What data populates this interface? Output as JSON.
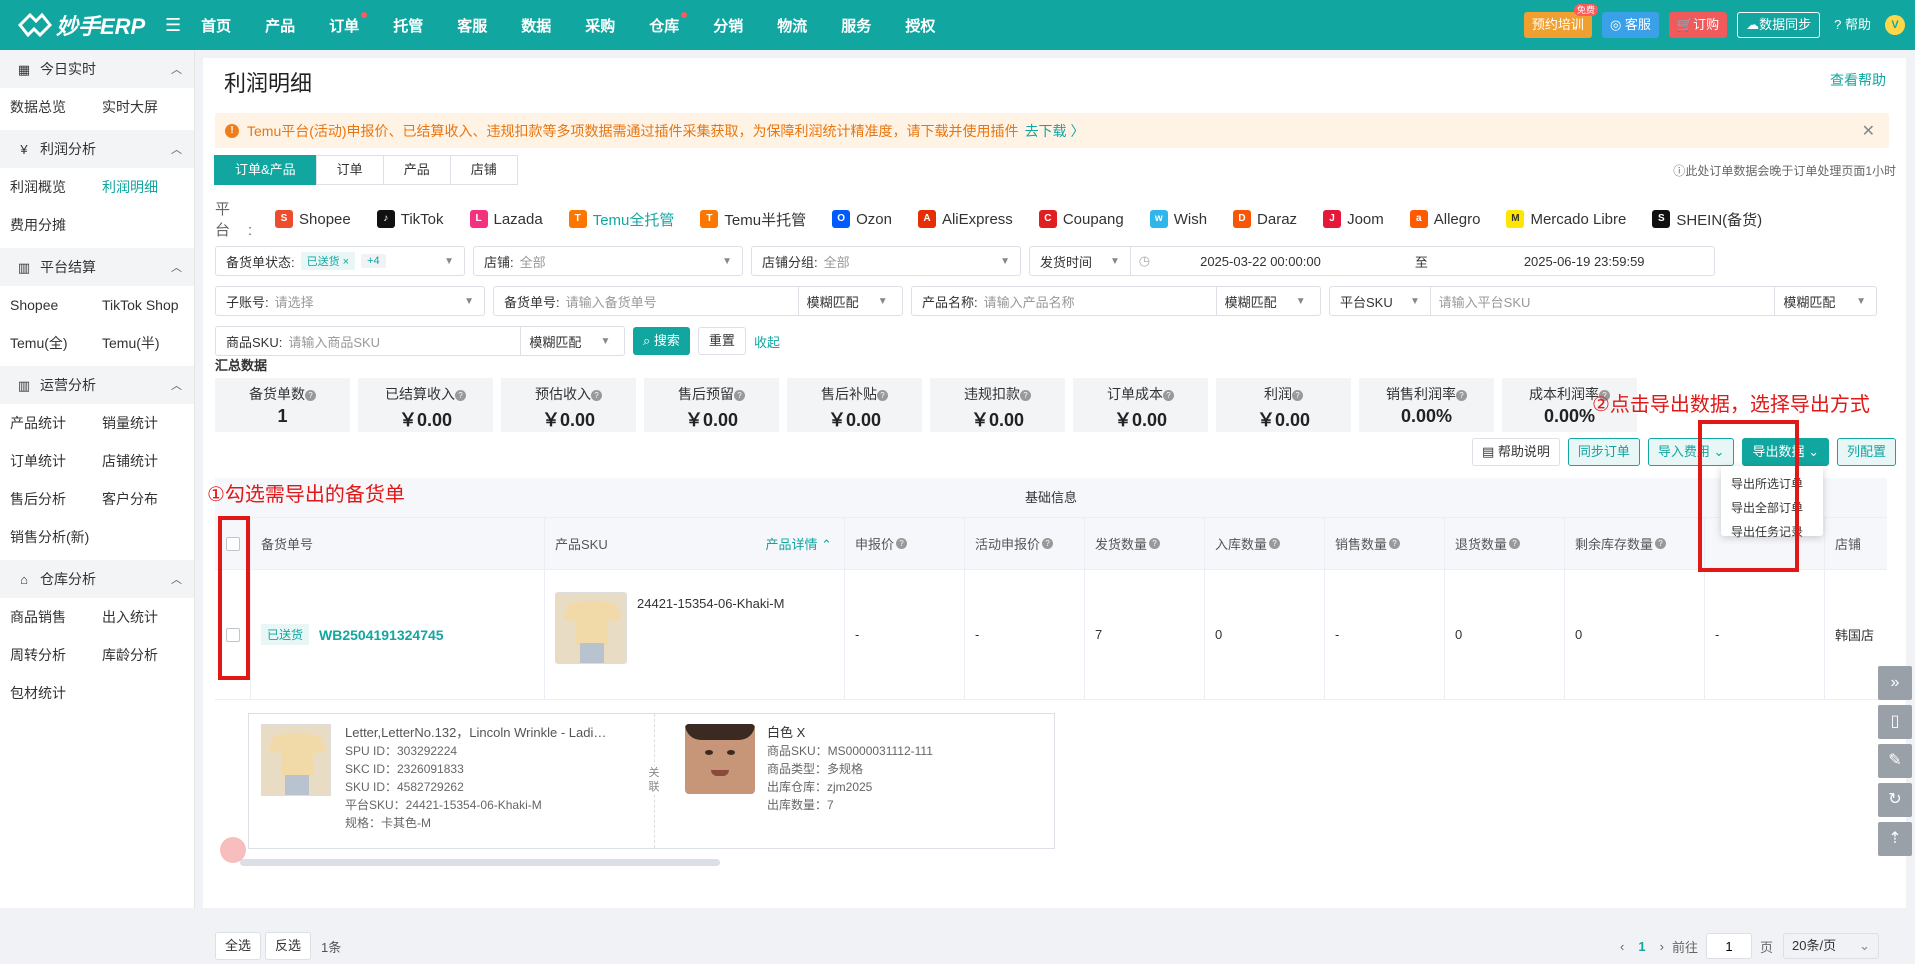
{
  "topbar": {
    "brand": "妙手ERP",
    "nav": [
      {
        "label": "首页",
        "dot": false
      },
      {
        "label": "产品",
        "dot": false
      },
      {
        "label": "订单",
        "dot": true
      },
      {
        "label": "托管",
        "dot": false
      },
      {
        "label": "客服",
        "dot": false
      },
      {
        "label": "数据",
        "dot": false
      },
      {
        "label": "采购",
        "dot": false
      },
      {
        "label": "仓库",
        "dot": true
      },
      {
        "label": "分销",
        "dot": false
      },
      {
        "label": "物流",
        "dot": false
      },
      {
        "label": "服务",
        "dot": false
      },
      {
        "label": "授权",
        "dot": false
      }
    ],
    "training": "预约培训",
    "free_tag": "免费",
    "service": "客服",
    "subscribe": "订购",
    "sync": "数据同步",
    "help": "帮助",
    "avatar": "V"
  },
  "sidebar": {
    "groups": [
      {
        "title": "今日实时",
        "icon": "calendar-icon",
        "items": [
          "数据总览",
          "实时大屏"
        ]
      },
      {
        "title": "利润分析",
        "icon": "yen-icon",
        "items": [
          "利润概览",
          "利润明细",
          "费用分摊"
        ]
      },
      {
        "title": "平台结算",
        "icon": "bar-chart-icon",
        "items": [
          "Shopee",
          "TikTok Shop",
          "Temu(全)",
          "Temu(半)"
        ]
      },
      {
        "title": "运营分析",
        "icon": "bar-chart-icon",
        "items": [
          "产品统计",
          "销量统计",
          "订单统计",
          "店铺统计",
          "售后分析",
          "客户分布",
          "销售分析(新)"
        ]
      },
      {
        "title": "仓库分析",
        "icon": "warehouse-icon",
        "items": [
          "商品销售",
          "出入统计",
          "周转分析",
          "库龄分析",
          "包材统计"
        ]
      }
    ],
    "active": "利润明细"
  },
  "page": {
    "title": "利润明细",
    "help_link": "查看帮助",
    "notice": "Temu平台(活动)申报价、已结算收入、违规扣款等多项数据需通过插件采集获取，为保障利润统计精准度，请下载并使用插件",
    "notice_link": "去下载 〉",
    "tabs": [
      "订单&产品",
      "订单",
      "产品",
      "店铺"
    ],
    "tab_note": "此处订单数据会晚于订单处理页面1小时",
    "platform_label": "平台:",
    "platforms": [
      {
        "name": "Shopee",
        "color": "#ee4d2d",
        "glyph": "S"
      },
      {
        "name": "TikTok",
        "color": "#111111",
        "glyph": "♪"
      },
      {
        "name": "Lazada",
        "color": "#f5317f",
        "glyph": "L"
      },
      {
        "name": "Temu全托管",
        "color": "#fb7701",
        "glyph": "T",
        "active": true
      },
      {
        "name": "Temu半托管",
        "color": "#fb7701",
        "glyph": "T"
      },
      {
        "name": "Ozon",
        "color": "#005bff",
        "glyph": "O"
      },
      {
        "name": "AliExpress",
        "color": "#e62e04",
        "glyph": "A"
      },
      {
        "name": "Coupang",
        "color": "#e02020",
        "glyph": "C"
      },
      {
        "name": "Wish",
        "color": "#2fb7ec",
        "glyph": "w"
      },
      {
        "name": "Daraz",
        "color": "#f85606",
        "glyph": "D"
      },
      {
        "name": "Joom",
        "color": "#e6183a",
        "glyph": "J"
      },
      {
        "name": "Allegro",
        "color": "#ff5a00",
        "glyph": "a"
      },
      {
        "name": "Mercado Libre",
        "color": "#ffe600",
        "glyph": "M"
      },
      {
        "name": "SHEIN(备货)",
        "color": "#111111",
        "glyph": "S"
      }
    ]
  },
  "filters": {
    "status_label": "备货单状态:",
    "status_chip": "已送货 ×",
    "status_more": "+4",
    "shop_label": "店铺:",
    "shop_value": "全部",
    "shop_group_label": "店铺分组:",
    "shop_group_value": "全部",
    "time_type": "发货时间",
    "date_start": "2025-03-22 00:00:00",
    "date_sep": "至",
    "date_end": "2025-06-19 23:59:59",
    "sub_account_label": "子账号:",
    "sub_account_placeholder": "请选择",
    "order_no_label": "备货单号:",
    "order_no_placeholder": "请输入备货单号",
    "match1": "模糊匹配",
    "product_name_label": "产品名称:",
    "product_name_placeholder": "请输入产品名称",
    "match2": "模糊匹配",
    "platform_sku_select": "平台SKU",
    "platform_sku_placeholder": "请输入平台SKU",
    "match3": "模糊匹配",
    "goods_sku_label": "商品SKU:",
    "goods_sku_placeholder": "请输入商品SKU",
    "match4": "模糊匹配",
    "search": "搜索",
    "reset": "重置",
    "collapse": "收起"
  },
  "summary": {
    "title": "汇总数据",
    "stats": [
      {
        "label": "备货单数",
        "value": "1"
      },
      {
        "label": "已结算收入",
        "value": "￥0.00"
      },
      {
        "label": "预估收入",
        "value": "￥0.00"
      },
      {
        "label": "售后预留",
        "value": "￥0.00"
      },
      {
        "label": "售后补贴",
        "value": "￥0.00"
      },
      {
        "label": "违规扣款",
        "value": "￥0.00"
      },
      {
        "label": "订单成本",
        "value": "￥0.00"
      },
      {
        "label": "利润",
        "value": "￥0.00"
      },
      {
        "label": "销售利润率",
        "value": "0.00%"
      },
      {
        "label": "成本利润率",
        "value": "0.00%"
      }
    ]
  },
  "actions": {
    "help_doc": "帮助说明",
    "sync_orders": "同步订单",
    "import_fee": "导入费用",
    "export": "导出数据",
    "config": "列配置",
    "export_menu": [
      "导出所选订单",
      "导出全部订单",
      "导出任务记录"
    ]
  },
  "table": {
    "group_header": "基础信息",
    "columns": [
      "备货单号",
      "产品SKU",
      "产品详情",
      "申报价",
      "活动申报价",
      "发货数量",
      "入库数量",
      "销售数量",
      "退货数量",
      "剩余库存数量",
      "",
      "店铺"
    ],
    "row": {
      "status": "已送货",
      "order_no": "WB2504191324745",
      "sku": "24421-15354-06-Khaki-M",
      "declare_price": "-",
      "activity_price": "-",
      "shipped": "7",
      "inbound": "0",
      "sold": "-",
      "returned": "0",
      "remaining": "0",
      "extra": "-",
      "shop": "韩国店"
    },
    "detail": {
      "title": "Letter,LetterNo.132，Lincoln Wrinkle - Ladi…",
      "spu": "SPU ID：303292224",
      "skc": "SKC ID：2326091833",
      "sku_id": "SKU ID：4582729262",
      "platform_sku": "平台SKU：24421-15354-06-Khaki-M",
      "spec": "规格：卡其色-M",
      "relation": "关联",
      "goods_title": "白色 X",
      "goods_sku": "商品SKU：MS0000031112-111",
      "goods_type": "商品类型：多规格",
      "warehouse": "出库仓库：zjm2025",
      "out_qty": "出库数量：7"
    }
  },
  "footer": {
    "select_all": "全选",
    "invert": "反选",
    "count": "1条",
    "current_page": "1",
    "goto": "前往",
    "page_input": "1",
    "page_unit": "页",
    "page_size": "20条/页"
  },
  "annotations": {
    "step1": "①勾选需导出的备货单",
    "step2": "②点击导出数据，选择导出方式"
  }
}
